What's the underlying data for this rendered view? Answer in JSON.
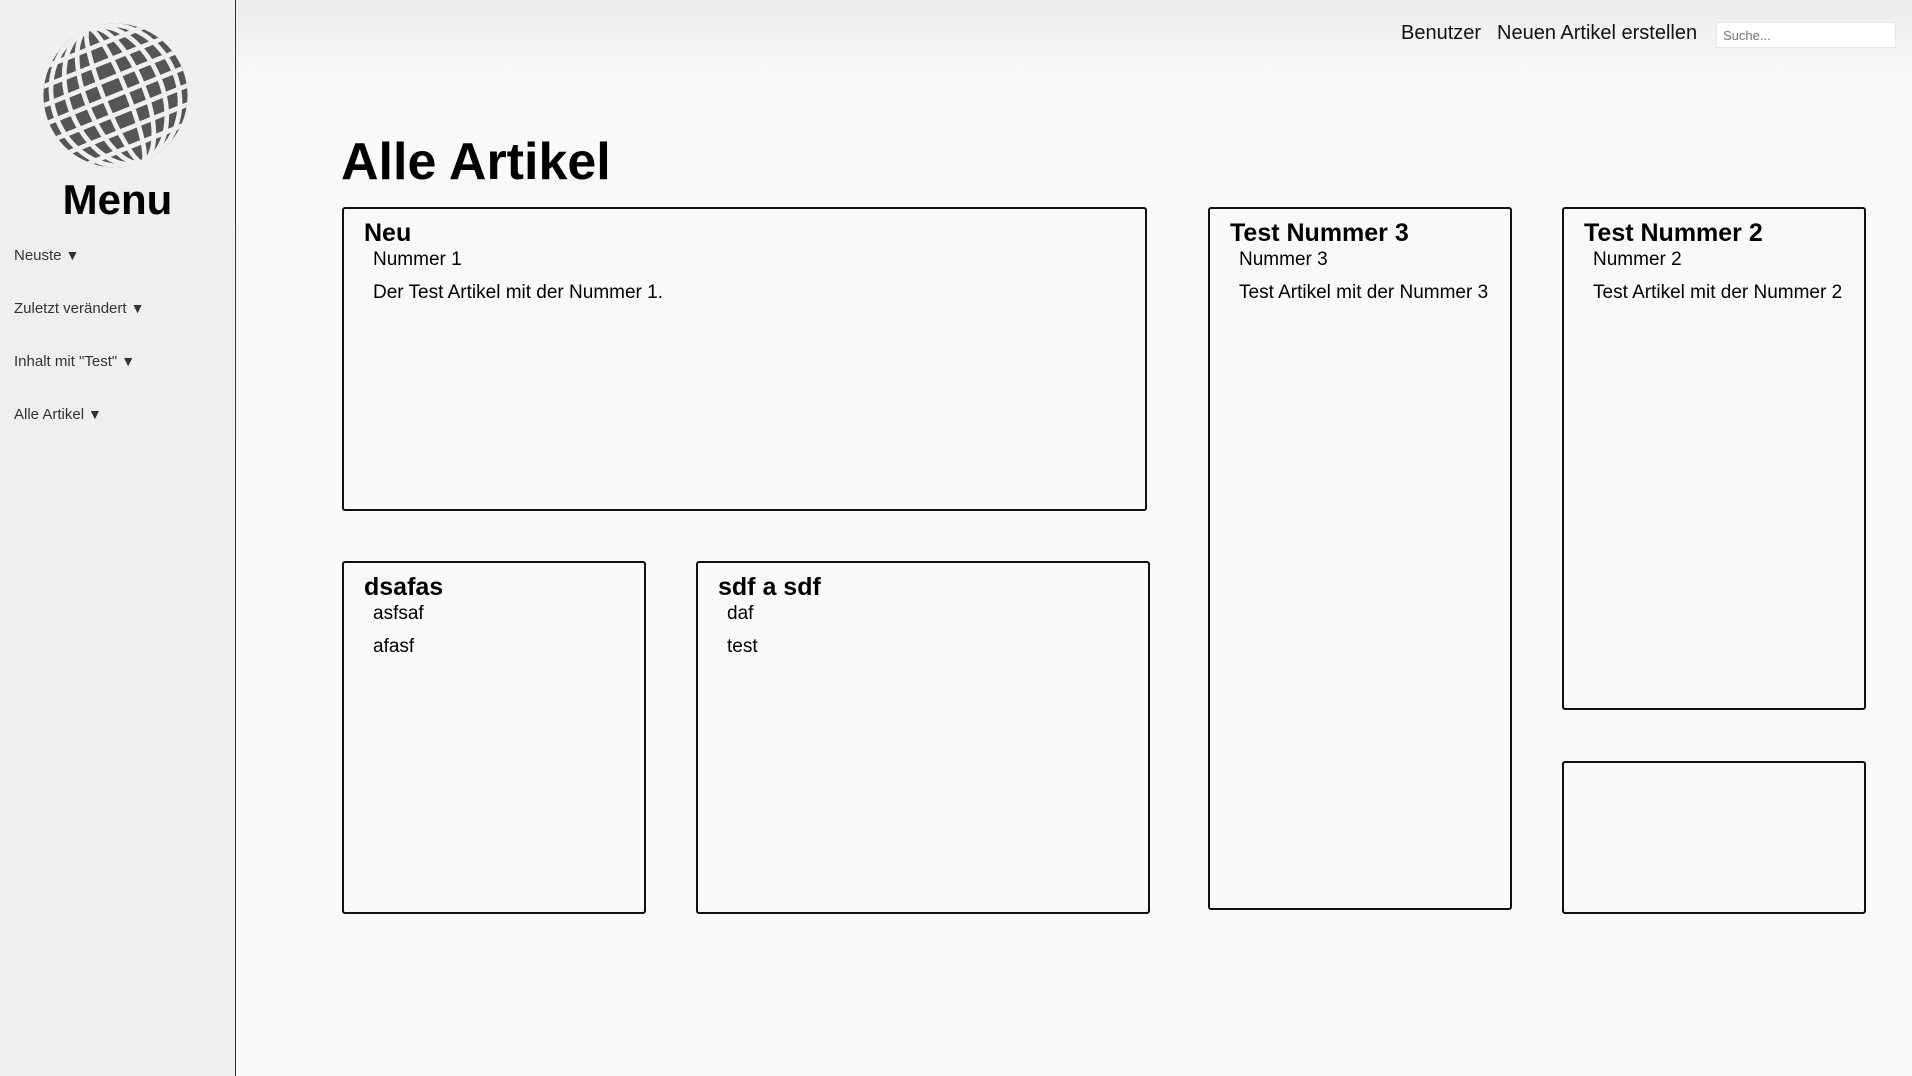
{
  "sidebar": {
    "logo_icon": "globe-icon",
    "title": "Menu",
    "items": [
      {
        "label": "Neuste",
        "arrow": "▼"
      },
      {
        "label": "Zuletzt verändert",
        "arrow": "▼"
      },
      {
        "label": "Inhalt mit \"Test\"",
        "arrow": "▼"
      },
      {
        "label": "Alle Artikel",
        "arrow": "▼"
      }
    ]
  },
  "header": {
    "nav": [
      {
        "label": "Benutzer"
      },
      {
        "label": "Neuen Artikel erstellen"
      }
    ],
    "search": {
      "placeholder": "Suche...",
      "value": ""
    }
  },
  "main": {
    "title": "Alle Artikel",
    "cards": [
      {
        "title": "Neu",
        "subtitle": "Nummer 1",
        "body": "Der Test Artikel mit der Nummer 1."
      },
      {
        "title": "Test Nummer 3",
        "subtitle": "Nummer 3",
        "body": "Test Artikel mit der Nummer 3"
      },
      {
        "title": "Test Nummer 2",
        "subtitle": "Nummer 2",
        "body": "Test Artikel mit der Nummer 2"
      },
      {
        "title": "dsafas",
        "subtitle": "asfsaf",
        "body": "afasf"
      },
      {
        "title": "sdf a sdf",
        "subtitle": "daf",
        "body": "test"
      },
      {
        "title": "",
        "subtitle": "",
        "body": ""
      }
    ]
  },
  "colors": {
    "sidebar_bg": "#f0f0f0",
    "page_bg": "#f9f9f9",
    "logo": "#555555",
    "border": "#111111"
  }
}
